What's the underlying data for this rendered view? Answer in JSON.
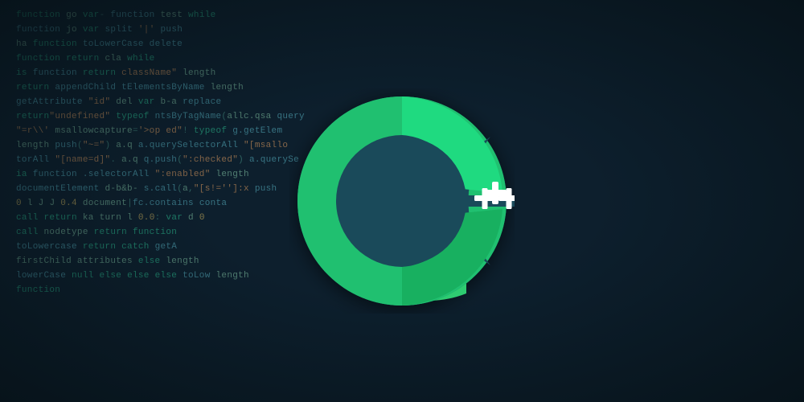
{
  "logo": {
    "alt": "C++ Programming Language Logo"
  },
  "background": {
    "code_lines": [
      {
        "text": "function go    var-          function    test              while"
      },
      {
        "text": "function jo    var           split  '|'     push"
      },
      {
        "text": "ha function                  toLowerCase                    delete"
      },
      {
        "text": "                function       return         clа          while"
      },
      {
        "text": "  is function    return      className\"                    length"
      },
      {
        "text": "    return   appendChild      tElementsByName    length"
      },
      {
        "text": "getAttribute \"id\"  del        var  b-a  replace"
      },
      {
        "text": "return\"undefined\"  typeof      ntsByTagName( all c. qs a-   query"
      },
      {
        "text": "\"=r\\\\' msallowcapture='>op    ed\"! typeof  g.getElem"
      },
      {
        "text": "  length  push(\"~=\") a.q       a.querySelectorAll \"[msallo"
      },
      {
        "text": "torAll \"[name=d]\".  a.q         q.push(\":checked\")  a.querySe"
      },
      {
        "text": "          ia function           .selectorAll \":enabled\"  length"
      },
      {
        "text": "    documentElement    d-b&b-    s.call(a,\"[s!='']:x    push"
      },
      {
        "text": "  0   l   J   J   0.4          document|fc.contains   conta"
      },
      {
        "text": "    call        return  ka       turn  l 0.0: var d 0"
      },
      {
        "text": "    call                         nodetype return  function"
      },
      {
        "text": "          toLowercase            return  catch   getA"
      },
      {
        "text": "  firstChild                     attributes     else   length"
      },
      {
        "text": "lowerCase  null   else           else   else  toLow   length"
      },
      {
        "text": "                                  function"
      }
    ]
  }
}
